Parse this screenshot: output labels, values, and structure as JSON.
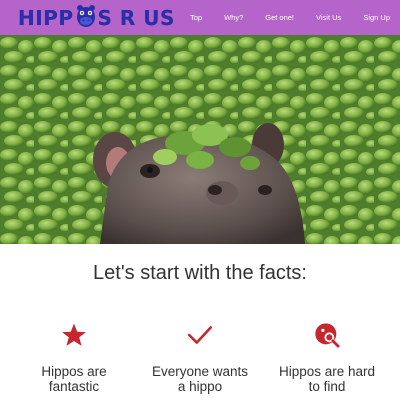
{
  "header": {
    "logo_text_left": "HIPP",
    "logo_text_right": "S R US",
    "background": "#b565c9",
    "nav": [
      {
        "label": "Top"
      },
      {
        "label": "Why?"
      },
      {
        "label": "Get one!"
      },
      {
        "label": "Visit Us"
      },
      {
        "label": "Sign Up"
      }
    ]
  },
  "hero": {
    "image": "hippo-in-water-lettuce"
  },
  "facts": {
    "title": "Let's start with the facts:",
    "accent": "#c6262e",
    "items": [
      {
        "icon": "star-icon",
        "text": "Hippos are fantastic"
      },
      {
        "icon": "checkmark-icon",
        "text": "Everyone wants a hippo"
      },
      {
        "icon": "search-location-icon",
        "text": "Hippos are hard to find"
      }
    ]
  }
}
